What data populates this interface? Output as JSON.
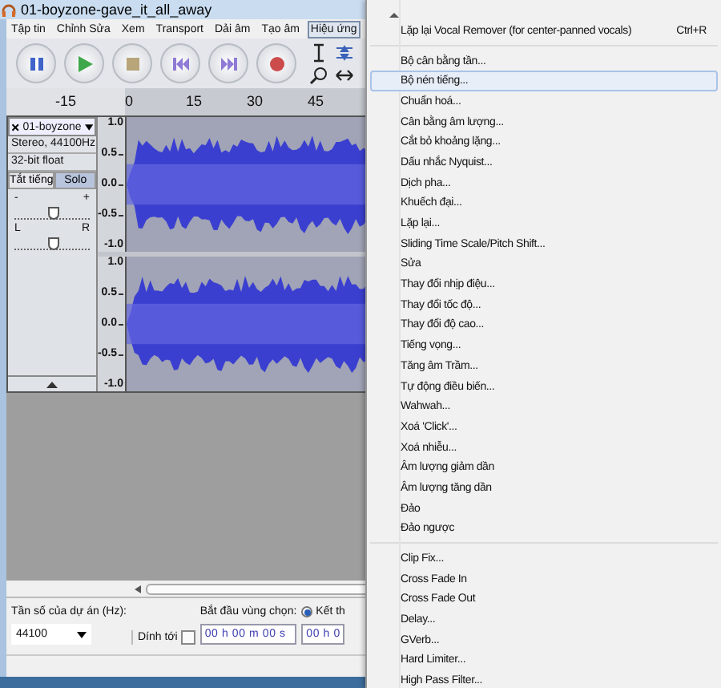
{
  "window": {
    "title": "01-boyzone-gave_it_all_away"
  },
  "menu_bar": [
    {
      "label": "Tập tin",
      "selected": false
    },
    {
      "label": "Chỉnh Sửa",
      "selected": false
    },
    {
      "label": "Xem",
      "selected": false
    },
    {
      "label": "Transport",
      "selected": false
    },
    {
      "label": "Dải âm",
      "selected": false
    },
    {
      "label": "Tạo âm",
      "selected": false
    },
    {
      "label": "Hiệu ứng",
      "selected": true
    }
  ],
  "ruler": {
    "ticks": [
      "-15",
      "0",
      "15",
      "30",
      "45"
    ]
  },
  "track": {
    "name": "01-boyzone",
    "info": [
      "Stereo, 44100Hz",
      "32-bit float"
    ],
    "mute_label": "Tắt tiếng",
    "solo_label": "Solo",
    "gain": {
      "min_label": "-",
      "max_label": "+",
      "level": 0.5
    },
    "pan": {
      "min_label": "L",
      "max_label": "R",
      "level": 0.5
    },
    "channels": [
      {
        "scale": [
          "1.0",
          "0.5",
          "0.0",
          "-0.5",
          "-1.0"
        ]
      },
      {
        "scale": [
          "1.0",
          "0.5",
          "0.0",
          "-0.5",
          "-1.0"
        ]
      }
    ]
  },
  "selection_bar": {
    "rate_label": "Tần số của dự án (Hz):",
    "rate_value": "44100",
    "snap_label": "Dính tới",
    "snap_checked": false,
    "start_label": "Bắt đầu vùng chọn:",
    "start_time": "00 h 00 m 00 s",
    "end_label": "Kết th",
    "end_selected": true,
    "end_time": "00 h 0"
  },
  "menu": {
    "groups": [
      [
        {
          "label": "Lặp lại Vocal Remover (for center-panned vocals)",
          "shortcut": "Ctrl+R",
          "selected": false
        }
      ],
      [
        {
          "label": "Bộ cân bằng tần...",
          "selected": false
        },
        {
          "label": "Bộ nén tiếng...",
          "selected": true
        },
        {
          "label": "Chuẩn hoá...",
          "selected": false
        },
        {
          "label": "Cân bằng âm lượng...",
          "selected": false
        },
        {
          "label": "Cắt bỏ khoảng lặng...",
          "selected": false
        },
        {
          "label": "Dấu nhắc Nyquist...",
          "selected": false
        },
        {
          "label": "Dịch pha...",
          "selected": false
        },
        {
          "label": "Khuếch đại...",
          "selected": false
        },
        {
          "label": "Lặp lại...",
          "selected": false
        },
        {
          "label": "Sliding Time Scale/Pitch Shift...",
          "selected": false
        },
        {
          "label": "Sửa",
          "selected": false
        },
        {
          "label": "Thay đổi nhịp điệu...",
          "selected": false
        },
        {
          "label": "Thay đổi tốc độ...",
          "selected": false
        },
        {
          "label": "Thay đổi độ cao...",
          "selected": false
        },
        {
          "label": "Tiếng vọng...",
          "selected": false
        },
        {
          "label": "Tăng âm Trầm...",
          "selected": false
        },
        {
          "label": "Tự động điều biến...",
          "selected": false
        },
        {
          "label": "Wahwah...",
          "selected": false
        },
        {
          "label": "Xoá 'Click'...",
          "selected": false
        },
        {
          "label": "Xoá nhiễu...",
          "selected": false
        },
        {
          "label": "Âm lượng giảm dần",
          "selected": false
        },
        {
          "label": "Âm lượng tăng dần",
          "selected": false
        },
        {
          "label": "Đảo",
          "selected": false
        },
        {
          "label": "Đảo ngược",
          "selected": false
        }
      ],
      [
        {
          "label": "Clip Fix...",
          "selected": false
        },
        {
          "label": "Cross Fade In",
          "selected": false
        },
        {
          "label": "Cross Fade Out",
          "selected": false
        },
        {
          "label": "Delay...",
          "selected": false
        },
        {
          "label": "GVerb...",
          "selected": false
        },
        {
          "label": "Hard Limiter...",
          "selected": false
        },
        {
          "label": "High Pass Filter...",
          "selected": false
        }
      ]
    ]
  }
}
